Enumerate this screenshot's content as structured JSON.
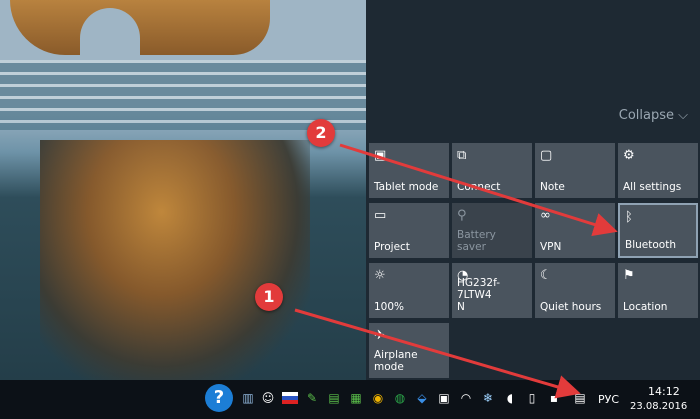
{
  "action_center": {
    "collapse_label": "Collapse ⌵",
    "tiles": [
      {
        "label": "Tablet mode",
        "icon": "tablet-icon"
      },
      {
        "label": "Connect",
        "icon": "connect-icon"
      },
      {
        "label": "Note",
        "icon": "note-icon"
      },
      {
        "label": "All settings",
        "icon": "gear-icon"
      },
      {
        "label": "Project",
        "icon": "project-icon"
      },
      {
        "label": "Battery saver",
        "icon": "battery-icon"
      },
      {
        "label": "VPN",
        "icon": "vpn-icon"
      },
      {
        "label": "Bluetooth",
        "icon": "bluetooth-icon"
      },
      {
        "label": "100%",
        "icon": "brightness-icon"
      },
      {
        "label": "HG232f-7LTW4\nN",
        "icon": "wifi-icon"
      },
      {
        "label": "Quiet hours",
        "icon": "moon-icon"
      },
      {
        "label": "Location",
        "icon": "location-icon"
      },
      {
        "label": "Airplane mode",
        "icon": "airplane-icon"
      }
    ]
  },
  "annotations": {
    "marker1": "1",
    "marker2": "2",
    "color": "#e23b3b"
  },
  "taskbar": {
    "language": "РУС",
    "time": "14:12",
    "date": "23.08.2016"
  }
}
